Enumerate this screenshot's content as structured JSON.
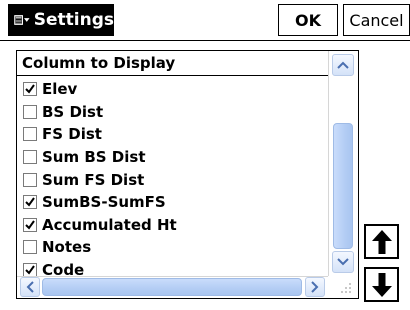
{
  "titlebar": {
    "title": "Settings",
    "ok_label": "OK",
    "cancel_label": "Cancel"
  },
  "list": {
    "header": "Column to Display",
    "items": [
      {
        "label": "Elev",
        "checked": true
      },
      {
        "label": "BS Dist",
        "checked": false
      },
      {
        "label": "FS Dist",
        "checked": false
      },
      {
        "label": "Sum BS Dist",
        "checked": false
      },
      {
        "label": "Sum FS Dist",
        "checked": false
      },
      {
        "label": "SumBS-SumFS",
        "checked": true
      },
      {
        "label": "Accumulated Ht",
        "checked": true
      },
      {
        "label": "Notes",
        "checked": false
      },
      {
        "label": "Code",
        "checked": true
      }
    ]
  },
  "icons": {
    "app_menu": "app-menu-icon",
    "dropdown": "caret-down-icon",
    "move_up": "arrow-up-icon",
    "move_down": "arrow-down-icon"
  },
  "colors": {
    "titlebar_bg": "#000000",
    "scrollbar_thumb": "#b3cdf4",
    "scrollbar_arrow": "#4a6fb0"
  }
}
